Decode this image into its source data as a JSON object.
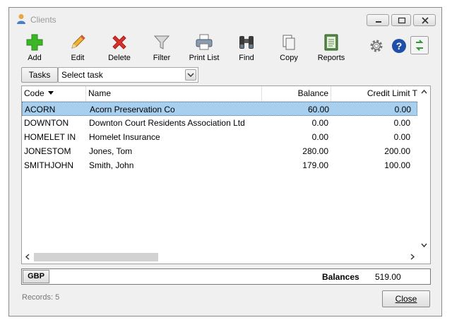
{
  "window": {
    "title": "Clients"
  },
  "toolbar": {
    "add": "Add",
    "edit": "Edit",
    "delete": "Delete",
    "filter": "Filter",
    "print_list": "Print List",
    "find": "Find",
    "copy": "Copy",
    "reports": "Reports"
  },
  "tasks": {
    "button_label": "Tasks",
    "select_value": "Select task"
  },
  "table": {
    "headers": {
      "code": "Code",
      "name": "Name",
      "balance": "Balance",
      "credit_limit": "Credit Limit T"
    },
    "rows": [
      {
        "code": "ACORN",
        "name": "Acorn Preservation Co",
        "balance": "60.00",
        "credit_limit": "0.00"
      },
      {
        "code": "DOWNTON",
        "name": "Downton Court Residents Association Ltd",
        "balance": "0.00",
        "credit_limit": "0.00"
      },
      {
        "code": "HOMELET IN",
        "name": "Homelet Insurance",
        "balance": "0.00",
        "credit_limit": "0.00"
      },
      {
        "code": "JONESTOM",
        "name": "Jones, Tom",
        "balance": "280.00",
        "credit_limit": "200.00"
      },
      {
        "code": "SMITHJOHN",
        "name": "Smith, John",
        "balance": "179.00",
        "credit_limit": "100.00"
      }
    ],
    "selected_row": 0
  },
  "footer": {
    "currency": "GBP",
    "balances_label": "Balances",
    "balances_value": "519.00",
    "records": "Records: 5",
    "close": "Close"
  },
  "colors": {
    "selection": "#a8d0ee",
    "add_green": "#3cb526",
    "delete_red": "#d9322a",
    "help_blue": "#1f4fa8"
  }
}
